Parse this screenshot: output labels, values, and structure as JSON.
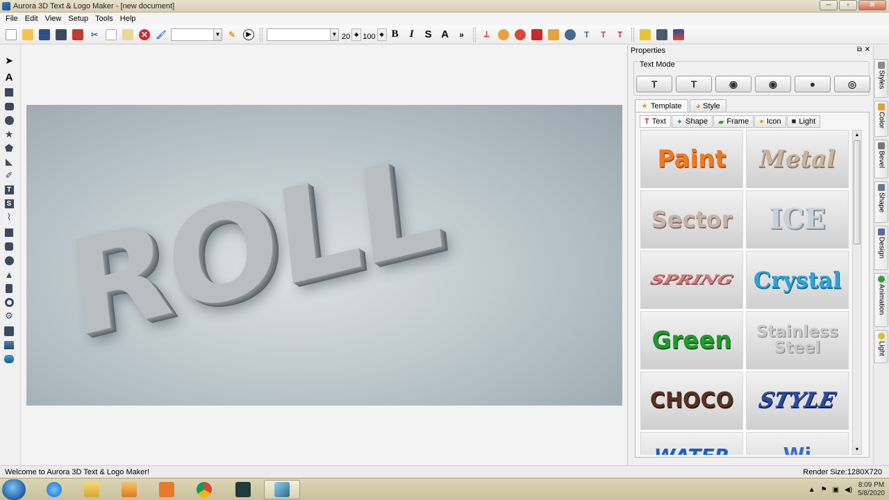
{
  "window": {
    "title": "Aurora 3D Text & Logo Maker - [new document]",
    "buttons": [
      "─",
      "▫",
      "✕"
    ]
  },
  "menu": [
    "File",
    "Edit",
    "View",
    "Setup",
    "Tools",
    "Help"
  ],
  "toolbar": {
    "font_size": "20",
    "percent": "100",
    "bold": "B",
    "italic": "I",
    "shadow": "S",
    "outline": "A"
  },
  "canvas": {
    "text": "ROLL"
  },
  "properties": {
    "title": "Properties",
    "text_mode_label": "Text Mode",
    "tabs": [
      "Template",
      "Style"
    ],
    "subtabs": [
      "Text",
      "Shape",
      "Frame",
      "Icon",
      "Light"
    ],
    "templates": [
      {
        "label": "Paint",
        "color": "#f07a1e"
      },
      {
        "label": "Metal",
        "color": "#c9b39d"
      },
      {
        "label": "Sector",
        "color": "#c7b3ad"
      },
      {
        "label": "ICE",
        "color": "#bcc6cc"
      },
      {
        "label": "SPRING",
        "color": "#d47a7a"
      },
      {
        "label": "Crystal",
        "color": "#2ea3d6"
      },
      {
        "label": "Green",
        "color": "#1f9a2d"
      },
      {
        "label": "Stainless Steel",
        "color": "#b8b8b8"
      },
      {
        "label": "CHOCO",
        "color": "#5a3020"
      },
      {
        "label": "STYLE",
        "color": "#2a4aa0"
      },
      {
        "label": "WATER",
        "color": "#1e5ec8"
      },
      {
        "label": "Wi",
        "color": "#3a6ad0"
      }
    ]
  },
  "sidetabs": [
    "Styles",
    "Color",
    "Bevel",
    "Shape",
    "Design",
    "Animation",
    "Light"
  ],
  "status": {
    "left": "Welcome to Aurora 3D Text & Logo Maker!",
    "right": "Render Size:1280X720"
  },
  "clock": {
    "time": "8:09 PM",
    "date": "5/8/2020"
  }
}
